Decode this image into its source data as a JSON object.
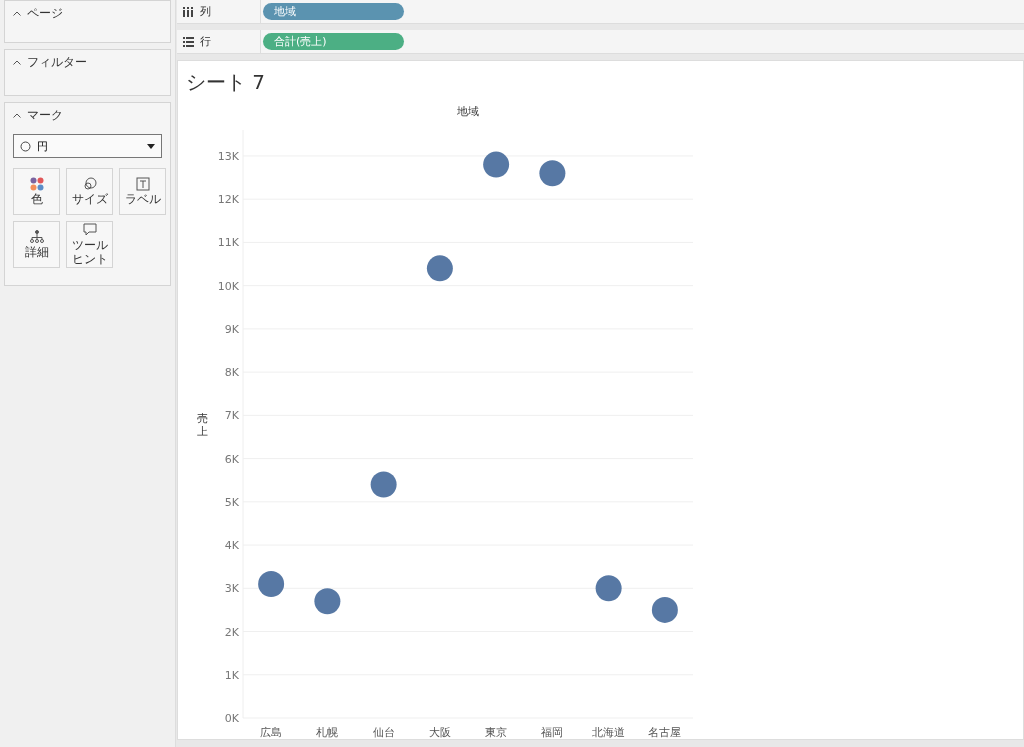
{
  "sidebar": {
    "cards": [
      {
        "title": "ページ"
      },
      {
        "title": "フィルター"
      }
    ],
    "marks": {
      "title": "マーク",
      "mark_type": "円",
      "buttons": [
        {
          "kind": "color",
          "label": "色"
        },
        {
          "kind": "size",
          "label": "サイズ"
        },
        {
          "kind": "label",
          "label": "ラベル"
        },
        {
          "kind": "detail",
          "label": "詳細"
        },
        {
          "kind": "tooltip",
          "label": "ツールヒント"
        }
      ]
    }
  },
  "shelves": [
    {
      "kind": "columns",
      "label": "列",
      "pill": "地域",
      "color": "#5b93b0"
    },
    {
      "kind": "rows",
      "label": "行",
      "pill": "合計(売上)",
      "color": "#4caf84"
    }
  ],
  "sheet": {
    "title": "シート 7",
    "chart_data": {
      "type": "scatter",
      "title": "地域",
      "ylabel": "売上",
      "categories": [
        "広島",
        "札幌",
        "仙台",
        "大阪",
        "東京",
        "福岡",
        "北海道",
        "名古屋"
      ],
      "grid": true,
      "series": [
        {
          "color": "#5778a4",
          "values": [
            3100,
            2700,
            5400,
            10400,
            12800,
            12600,
            3000,
            2500
          ]
        }
      ],
      "ylim": [
        0,
        13600
      ],
      "yticks": [
        {
          "value": 0,
          "label": "0K"
        },
        {
          "value": 1000,
          "label": "1K"
        },
        {
          "value": 2000,
          "label": "2K"
        },
        {
          "value": 3000,
          "label": "3K"
        },
        {
          "value": 4000,
          "label": "4K"
        },
        {
          "value": 5000,
          "label": "5K"
        },
        {
          "value": 6000,
          "label": "6K"
        },
        {
          "value": 7000,
          "label": "7K"
        },
        {
          "value": 8000,
          "label": "8K"
        },
        {
          "value": 9000,
          "label": "9K"
        },
        {
          "value": 10000,
          "label": "10K"
        },
        {
          "value": 11000,
          "label": "11K"
        },
        {
          "value": 12000,
          "label": "12K"
        },
        {
          "value": 13000,
          "label": "13K"
        }
      ]
    }
  }
}
